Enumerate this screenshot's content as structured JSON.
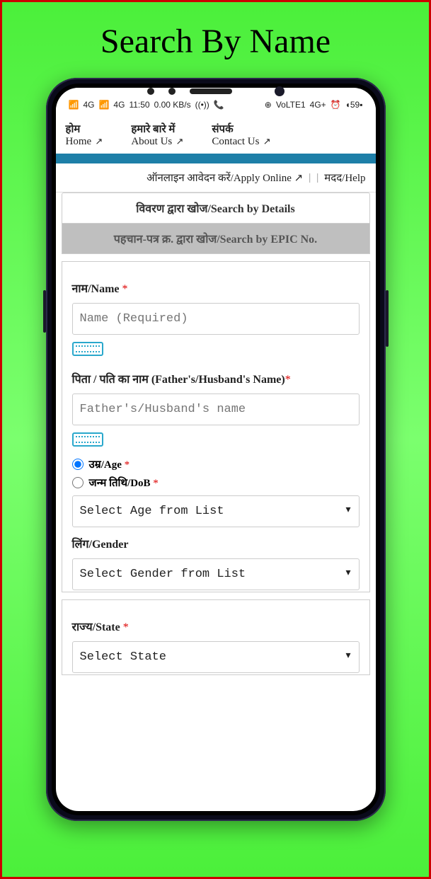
{
  "page_title": "Search By Name",
  "status": {
    "time": "11:50",
    "net": "0.00 KB/s",
    "signal1": "4G",
    "signal2": "4G",
    "right1": "VoLTE1",
    "right2": "4G+",
    "battery": "59"
  },
  "nav": {
    "home": {
      "hi": "होम",
      "en": "Home"
    },
    "about": {
      "hi": "हमारे बारे में",
      "en": "About Us"
    },
    "contact": {
      "hi": "संपर्क",
      "en": "Contact Us"
    }
  },
  "subbar": {
    "apply": "ऑनलाइन आवेदन करें/Apply Online",
    "help": "मदद/Help"
  },
  "tabs": {
    "details": "विवरण द्वारा खोज/Search by Details",
    "epic": "पहचान-पत्र क्र. द्वारा खोज/Search by EPIC No."
  },
  "form": {
    "name_label": "नाम/Name",
    "name_placeholder": "Name (Required)",
    "father_label": "पिता / पति का नाम (Father's/Husband's Name)",
    "father_placeholder": "Father's/Husband's name",
    "age_label": "उम्र/Age",
    "dob_label": "जन्म तिथि/DoB",
    "age_select": "Select Age from List",
    "gender_label": "लिंग/Gender",
    "gender_select": "Select Gender from List",
    "state_label": "राज्य/State",
    "state_select": "Select State"
  }
}
